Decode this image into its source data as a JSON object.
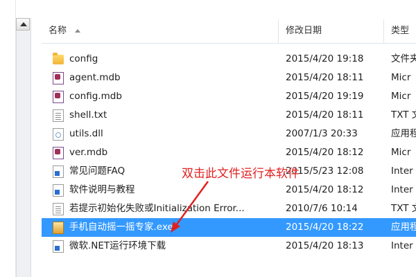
{
  "header": {
    "name_label": "名称",
    "date_label": "修改日期",
    "type_label": "类型"
  },
  "files": [
    {
      "name": "config",
      "date": "2015/4/20 19:18",
      "type": "文件夹",
      "icon": "folder-icon"
    },
    {
      "name": "agent.mdb",
      "date": "2015/4/20 18:11",
      "type": "Micr",
      "icon": "database-file-icon"
    },
    {
      "name": "config.mdb",
      "date": "2015/4/20 19:19",
      "type": "Micr",
      "icon": "database-file-icon"
    },
    {
      "name": "shell.txt",
      "date": "2015/4/20 18:11",
      "type": "TXT 文",
      "icon": "text-file-icon"
    },
    {
      "name": "utils.dll",
      "date": "2007/1/3 20:33",
      "type": "应用程",
      "icon": "dll-file-icon"
    },
    {
      "name": "ver.mdb",
      "date": "2015/4/20 18:12",
      "type": "Micr",
      "icon": "database-file-icon"
    },
    {
      "name": "常见问题FAQ",
      "date": "2015/5/23 12:08",
      "type": "Inter",
      "icon": "shortcut-icon"
    },
    {
      "name": "软件说明与教程",
      "date": "2015/4/20 18:12",
      "type": "Inter",
      "icon": "shortcut-icon"
    },
    {
      "name": "若提示初始化失败或Initialization Error...",
      "date": "2010/7/6 10:14",
      "type": "TXT 文",
      "icon": "text-file-icon"
    },
    {
      "name": "手机自动摇一摇专家.exe",
      "date": "2015/4/20 18:22",
      "type": "应用程",
      "icon": "exe-file-icon",
      "selected": true
    },
    {
      "name": "微软.NET运行环境下载",
      "date": "2015/4/20 18:13",
      "type": "Inter",
      "icon": "shortcut-icon"
    }
  ],
  "annotation": {
    "text": "双击此文件运行本软件",
    "color": "#e02020"
  },
  "colors": {
    "selection": "#3399ff",
    "header_border": "#dde5ee"
  }
}
